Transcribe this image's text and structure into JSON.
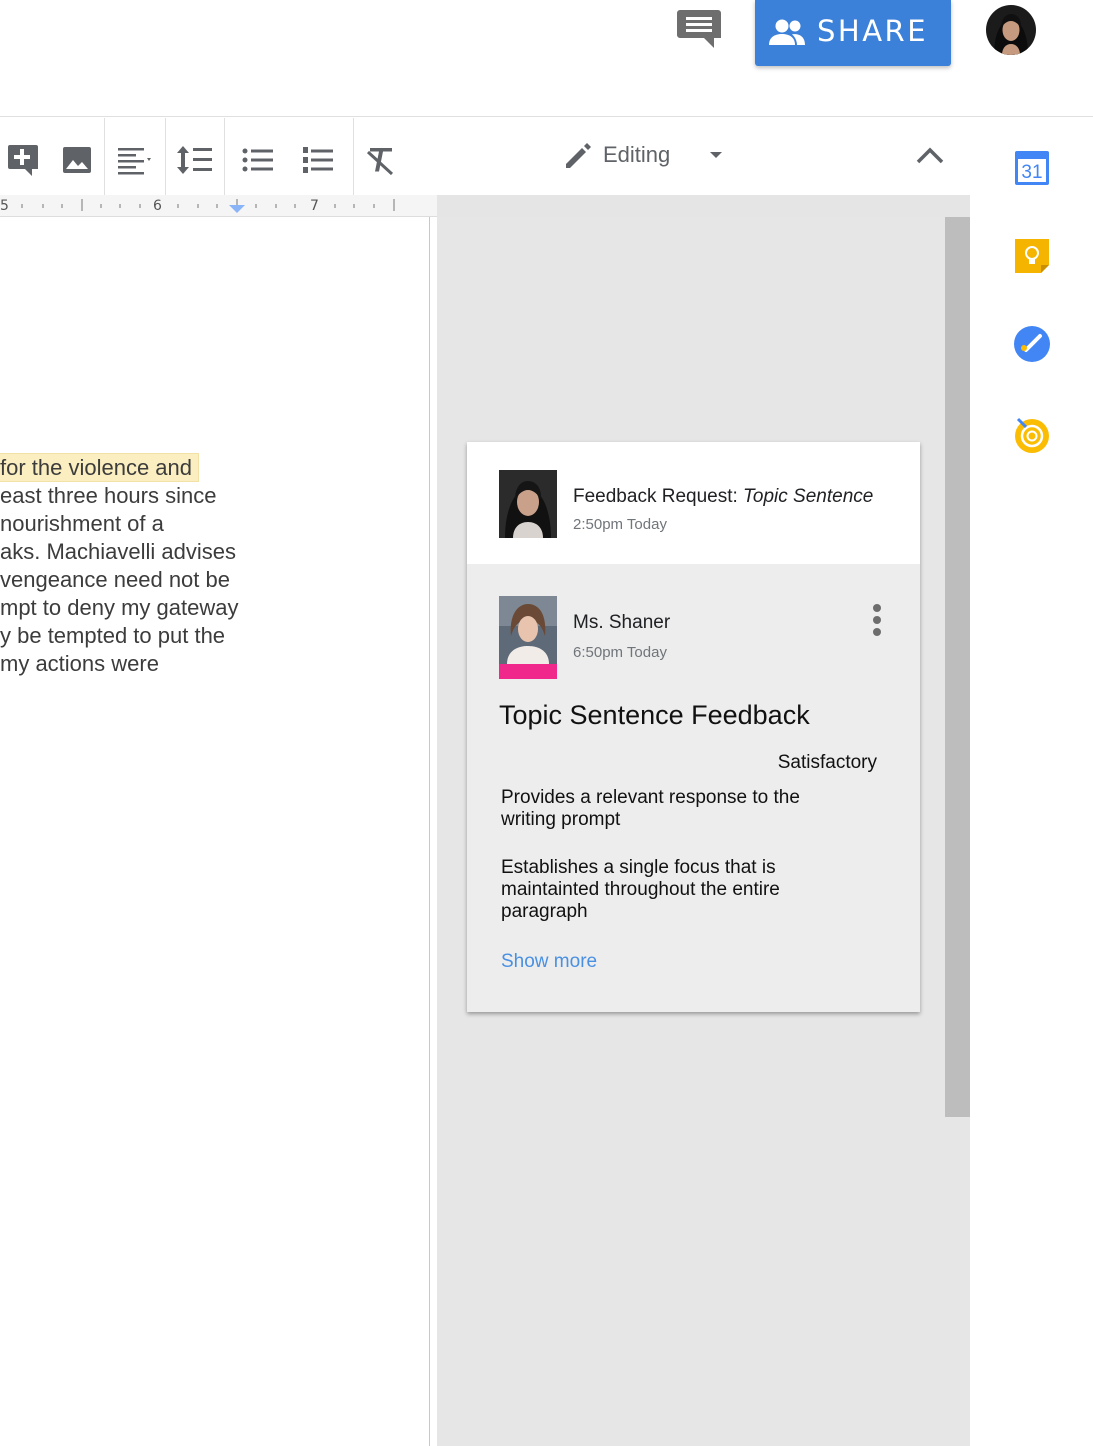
{
  "header": {
    "share_label": "SHARE"
  },
  "toolbar": {
    "editing_label": "Editing"
  },
  "ruler": {
    "numbers": [
      "5",
      "6",
      "7"
    ]
  },
  "document": {
    "lines": [
      "for the violence and",
      "east three hours since",
      "nourishment of a",
      "aks. Machiavelli advises",
      "vengeance need not be",
      "mpt to deny my gateway",
      "y be tempted to put the",
      "my actions were"
    ]
  },
  "feedback_request": {
    "title_prefix": "Feedback Request:",
    "title_topic": "Topic Sentence",
    "time": "2:50pm Today"
  },
  "feedback": {
    "teacher_name": "Ms. Shaner",
    "time": "6:50pm Today",
    "title": "Topic Sentence Feedback",
    "rating": "Satisfactory",
    "criteria": [
      "Provides a relevant response to the writing prompt",
      "Establishes a single focus that is maintainted throughout the entire paragraph"
    ],
    "show_more": "Show more"
  },
  "rail": {
    "calendar_day": "31"
  },
  "colors": {
    "share_blue": "#3b80d9",
    "link_blue": "#4a90e2",
    "teacher_tag": "#f0288b",
    "highlight": "#fbeec0",
    "keep_yellow": "#f4b400"
  },
  "icons": [
    "comments-icon",
    "people-icon",
    "insert-comment-icon",
    "image-icon",
    "align-left-icon",
    "line-spacing-icon",
    "bulleted-list-icon",
    "numbered-list-icon",
    "clear-formatting-icon",
    "pencil-icon",
    "chevron-up-icon",
    "calendar-icon",
    "keep-icon",
    "tasks-icon",
    "addon-icon"
  ]
}
